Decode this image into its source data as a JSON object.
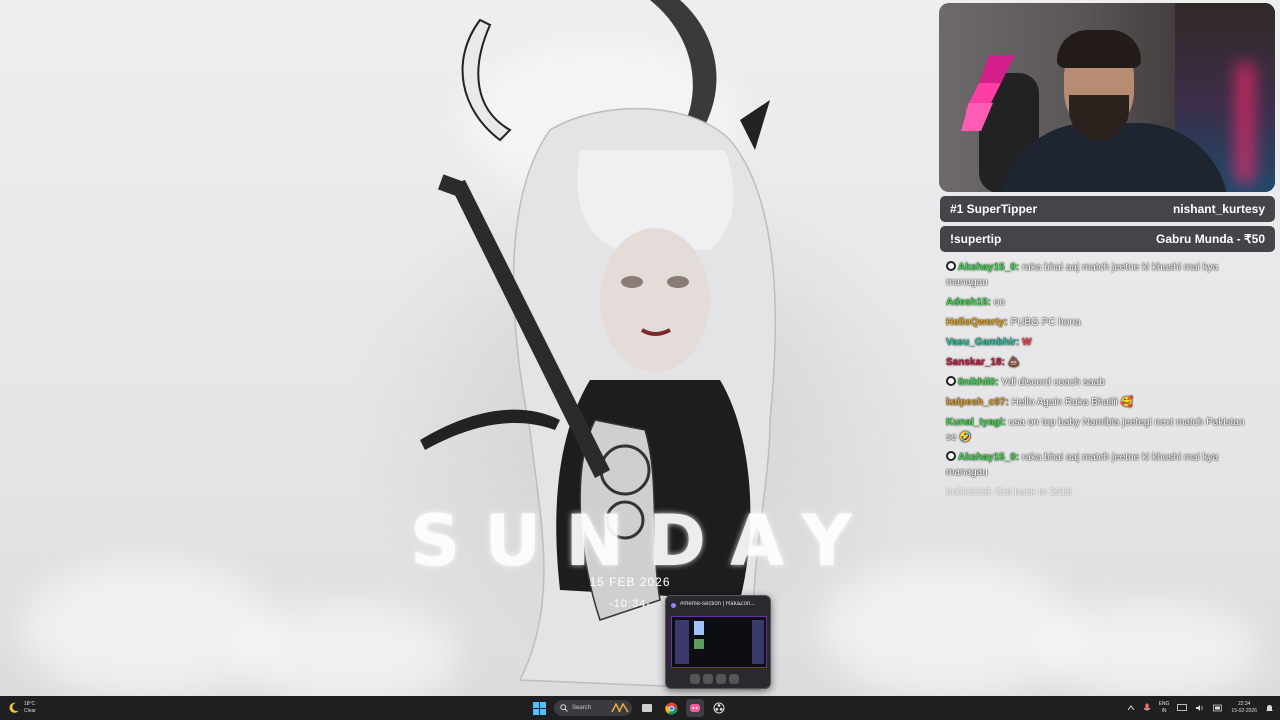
{
  "wallpaper": {
    "day_text": "SUNDAY",
    "date_text": "15 FEB 2026",
    "time_text": "-10:34-"
  },
  "window_preview": {
    "title": "#meme-section | RakaZon..."
  },
  "info_bars": [
    {
      "label": "#1 SuperTipper",
      "value": "nishant_kurtesy"
    },
    {
      "label": "!supertip",
      "value": "Gabru Munda - ₹50"
    }
  ],
  "chat": {
    "messages": [
      {
        "user": "Akshay15_0:",
        "color": "#3cd94b",
        "badge": "panda-icon",
        "text": "raka bhai aaj match jeetne ki khushi mai kya managau"
      },
      {
        "user": "Adesh15:",
        "color": "#3cd94b",
        "badge": "",
        "text": "oo"
      },
      {
        "user": "HelloQwerty:",
        "color": "#e0a31c",
        "badge": "",
        "text": "PUBG PC hona"
      },
      {
        "user": "Vasu_Gambhir:",
        "color": "#23c29f",
        "badge": "",
        "text": "W"
      },
      {
        "user": "Sanskar_18:",
        "color": "#c8163e",
        "badge": "",
        "text": "💩"
      },
      {
        "user": "0nikhil0:",
        "color": "#3cd94b",
        "badge": "panda-icon",
        "text": "Vdl discord coach saab"
      },
      {
        "user": "kalpesh_c97:",
        "color": "#d89c2c",
        "badge": "",
        "text": "Hello Again Raka Bhaiiii 🥰"
      },
      {
        "user": "Kunal_tyagi:",
        "color": "#3cd94b",
        "badge": "",
        "text": "usa on top baby Namibia jeetegi next match Pakistan se 🤣"
      },
      {
        "user": "Akshay15_0:",
        "color": "#3cd94b",
        "badge": "panda-icon",
        "text": "raka bhai aaj match jeetne ki khushi mai kya managau"
      }
    ],
    "faded_message": "bo0k2026: Got back to 2018"
  },
  "taskbar": {
    "weather_temp": "18°C",
    "weather_cond": "Clear",
    "search_label": "Search",
    "lang_top": "ENG",
    "lang_bottom": "IN",
    "clock_time": "22:34",
    "clock_date": "15-02-2026"
  },
  "colors": {
    "taskbar_bg": "#1f1f22",
    "info_bar_bg": "#2d2d32",
    "logo_pink": "#ff3ea5",
    "logo_magenta": "#d21f8c"
  }
}
